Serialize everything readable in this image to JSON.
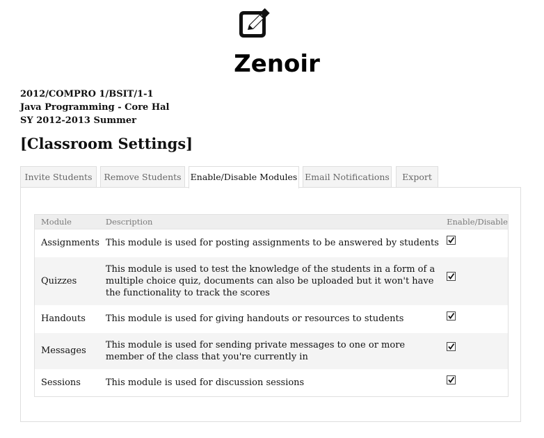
{
  "brand": {
    "name": "Zenoir",
    "logo_icon": "pencil-square-icon"
  },
  "course": {
    "code": "2012/COMPRO 1/BSIT/1-1",
    "subject": "Java Programming - Core Hal",
    "term": "SY 2012-2013 Summer"
  },
  "page_title": "[Classroom Settings]",
  "tabs": [
    {
      "label": "Invite Students",
      "active": false
    },
    {
      "label": "Remove Students",
      "active": false
    },
    {
      "label": "Enable/Disable Modules",
      "active": true
    },
    {
      "label": "Email Notifications",
      "active": false
    },
    {
      "label": "Export",
      "active": false
    }
  ],
  "table": {
    "headers": {
      "module": "Module",
      "description": "Description",
      "toggle": "Enable/Disable"
    },
    "rows": [
      {
        "module": "Assignments",
        "description": "This module is used for posting assignments to be answered by students",
        "enabled": true
      },
      {
        "module": "Quizzes",
        "description": "This module is used to test the knowledge of the students in a form of a multiple choice quiz, documents can also be uploaded but it won't have the functionality to track the scores",
        "enabled": true
      },
      {
        "module": "Handouts",
        "description": "This module is used for giving handouts or resources to students",
        "enabled": true
      },
      {
        "module": "Messages",
        "description": "This module is used for sending private messages to one or more member of the class that you're currently in",
        "enabled": true
      },
      {
        "module": "Sessions",
        "description": "This module is used for discussion sessions",
        "enabled": true
      }
    ]
  }
}
